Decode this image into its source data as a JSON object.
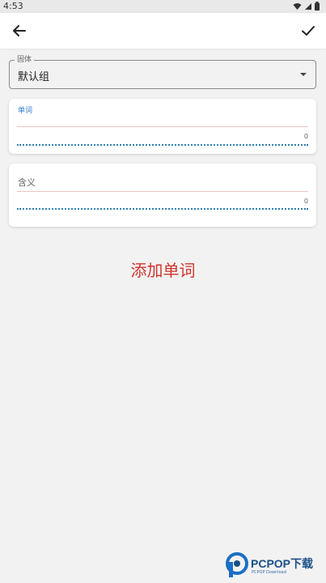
{
  "status_bar": {
    "time": "4:53",
    "icons": [
      "wifi-icon",
      "signal-icon",
      "battery-icon"
    ]
  },
  "app_bar": {
    "back_icon": "arrow-left-icon",
    "confirm_icon": "check-icon"
  },
  "group": {
    "label": "固体",
    "value": "默认组",
    "icon": "dropdown-arrow-icon"
  },
  "word_field": {
    "label": "单词",
    "value": "",
    "count": "0"
  },
  "meaning_field": {
    "label": "含义",
    "value": "",
    "count": "0"
  },
  "add_button": {
    "label": "添加单词"
  },
  "watermark": {
    "brand": "PCPOP下载",
    "sub": "PCPOP Download"
  },
  "colors": {
    "accent_red": "#d0342c",
    "accent_blue": "#2f7fd1",
    "background": "#f2f2f2"
  }
}
